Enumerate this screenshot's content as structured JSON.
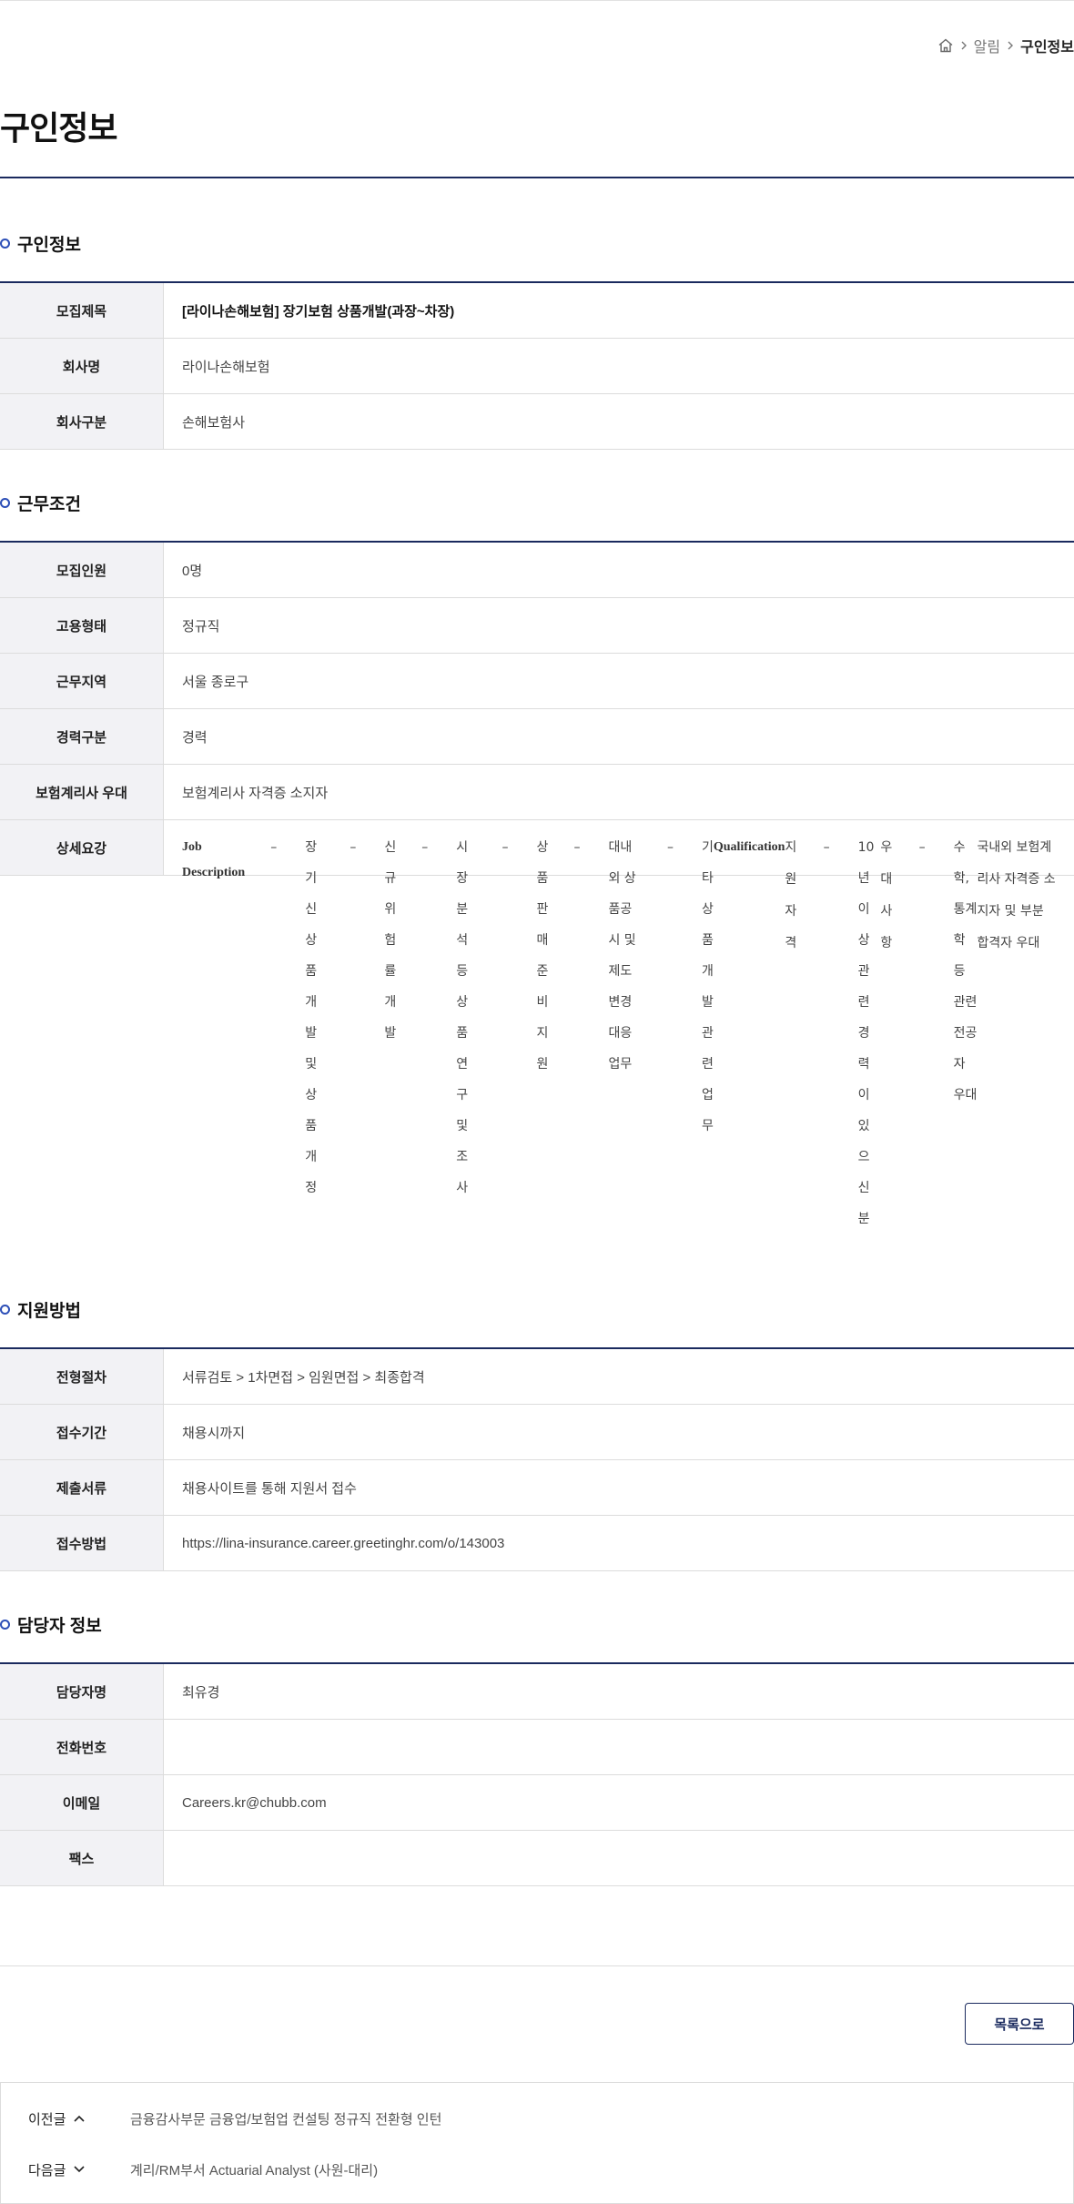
{
  "breadcrumb": {
    "home_icon": "home-icon",
    "items": [
      "알림",
      "구인정보"
    ]
  },
  "page_title": "구인정보",
  "sections": [
    {
      "title": "구인정보",
      "rows": [
        {
          "label": "모집제목",
          "value": "[라이나손해보험] 장기보험 상품개발(과장~차장)"
        },
        {
          "label": "회사명",
          "value": "라이나손해보험"
        },
        {
          "label": "회사구분",
          "value": "손해보험사"
        }
      ]
    },
    {
      "title": "근무조건",
      "rows": [
        {
          "label": "모집인원",
          "value": "0명"
        },
        {
          "label": "고용형태",
          "value": "정규직"
        },
        {
          "label": "근무지역",
          "value": "서울 종로구"
        },
        {
          "label": "경력구분",
          "value": "경력"
        },
        {
          "label": "보험계리사 우대",
          "value": "보험계리사 자격증 소지자"
        }
      ],
      "detail": {
        "label": "상세요강",
        "lines": [
          {
            "type": "heading",
            "text": "Job Description"
          },
          {
            "type": "bullet",
            "dash": "–",
            "text": "장기 신상품 개발 및 상품 개정"
          },
          {
            "type": "bullet",
            "dash": "–",
            "text": "신규 위험률 개발"
          },
          {
            "type": "bullet",
            "dash": "–",
            "text": "시장 분석 등 상품 연구 및 조사"
          },
          {
            "type": "bullet",
            "dash": "–",
            "text": "상품 판매 준비 지원"
          },
          {
            "type": "bullet",
            "dash": "–",
            "text": "대내외 상품공시 및 제도 변경 대응 업무"
          },
          {
            "type": "bullet",
            "dash": "–",
            "text": "기타 상품개발 관련 업무"
          },
          {
            "type": "heading",
            "text": "Qualification"
          },
          {
            "type": "plain",
            "text": "지원자격"
          },
          {
            "type": "bullet",
            "dash": "–",
            "text": "10년 이상 관련 경력이 있으신분"
          },
          {
            "type": "plain",
            "text": "우대사항"
          },
          {
            "type": "bullet",
            "dash": "–",
            "text": "수학, 통계학 등 관련 전공자 우대"
          },
          {
            "type": "plain",
            "text": "국내외 보험계리사 자격증 소지자 및 부분 합격자 우대"
          }
        ]
      }
    },
    {
      "title": "지원방법",
      "rows": [
        {
          "label": "전형절차",
          "value": "서류검토 > 1차면접 > 임원면접 > 최종합격"
        },
        {
          "label": "접수기간",
          "value": "채용시까지"
        },
        {
          "label": "제출서류",
          "value": "채용사이트를 통해 지원서 접수"
        },
        {
          "label": "접수방법",
          "value": "https://lina-insurance.career.greetinghr.com/o/143003"
        }
      ]
    },
    {
      "title": "담당자 정보",
      "rows": [
        {
          "label": "담당자명",
          "value": "최유경"
        },
        {
          "label": "전화번호",
          "value": ""
        },
        {
          "label": "이메일",
          "value": "Careers.kr@chubb.com"
        },
        {
          "label": "팩스",
          "value": ""
        }
      ]
    }
  ],
  "list_button": "목록으로",
  "prev_next": {
    "prev_label": "이전글",
    "prev_title": "금융감사부문 금융업/보험업 컨설팅 정규직 전환형 인턴",
    "next_label": "다음글",
    "next_title": "계리/RM부서 Actuarial Analyst (사원-대리)"
  },
  "colors": {
    "navy": "#1a2a5e",
    "accent_blue": "#2d4fb7",
    "label_bg": "#f2f2f5"
  }
}
